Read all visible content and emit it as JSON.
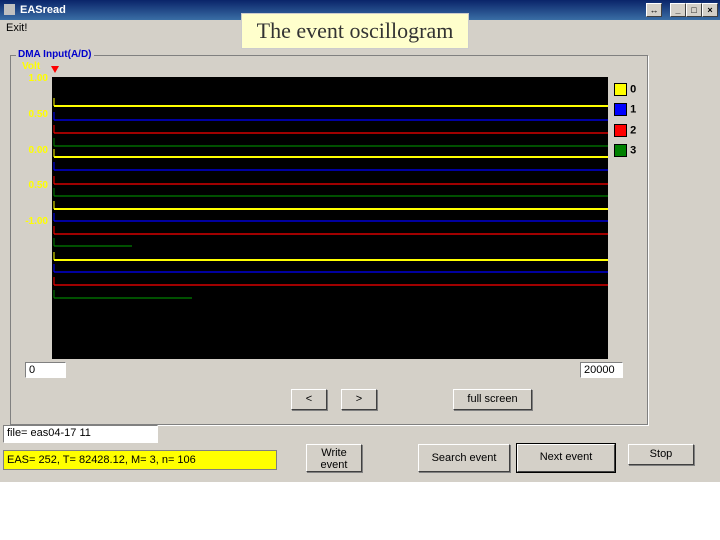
{
  "window": {
    "title": "EASread",
    "menu": [
      "Exit!"
    ]
  },
  "caption": "The event oscillogram",
  "group": {
    "label": "DMA Input(A/D)",
    "unit": "Volt",
    "y_ticks": [
      "1.00",
      "0.50",
      "0.00",
      "0.50",
      "-1.00"
    ]
  },
  "legend": [
    {
      "label": "0",
      "color": "#ffff00"
    },
    {
      "label": "1",
      "color": "#0000ff"
    },
    {
      "label": "2",
      "color": "#ff0000"
    },
    {
      "label": "3",
      "color": "#008000"
    }
  ],
  "range": {
    "start": "0",
    "end": "20000"
  },
  "nav": {
    "prev": "<",
    "next": ">",
    "full_screen": "full screen"
  },
  "file": "file= eas04-17 11",
  "status": "EAS=  252,   T= 82428.12,   M= 3,  n= 106",
  "buttons": {
    "write_event": "Write event",
    "search_event": "Search event",
    "next_event": "Next event",
    "stop": "Stop"
  }
}
